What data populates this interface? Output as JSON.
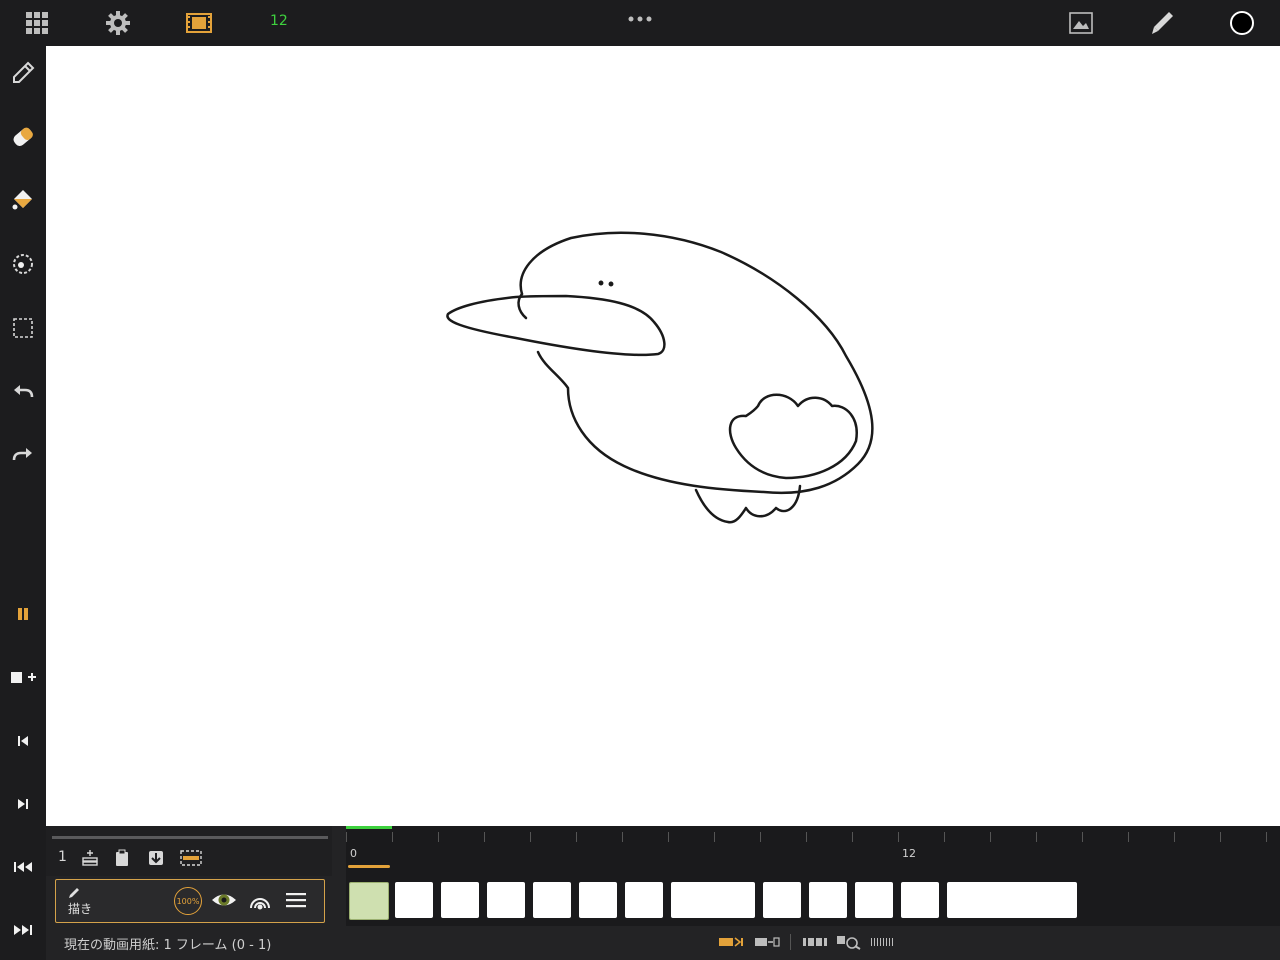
{
  "topbar": {
    "fps": "12",
    "icons": [
      "grid-icon",
      "gear-icon",
      "film-icon",
      "more-icon",
      "image-icon",
      "brush-icon",
      "color-icon"
    ],
    "colors": {
      "film": "#e3a23a",
      "fps": "#3ed13e",
      "color_swatch": "#000000"
    }
  },
  "sidebar": {
    "tools": [
      "pencil-icon",
      "eraser-icon",
      "fill-icon",
      "lasso-icon",
      "selection-icon",
      "undo-icon",
      "redo-icon"
    ],
    "playback": [
      "pause-icon",
      "add-frame-icon",
      "prev-frame-icon",
      "next-frame-icon",
      "first-frame-icon",
      "last-frame-icon"
    ]
  },
  "layers": {
    "count": "1",
    "name": "描き",
    "opacity": "100%"
  },
  "timeline": {
    "ruler_labels": [
      "0",
      "12"
    ],
    "current_frame": 0
  },
  "status": {
    "text": "現在の動画用紙: 1 フレーム (0 - 1)"
  }
}
